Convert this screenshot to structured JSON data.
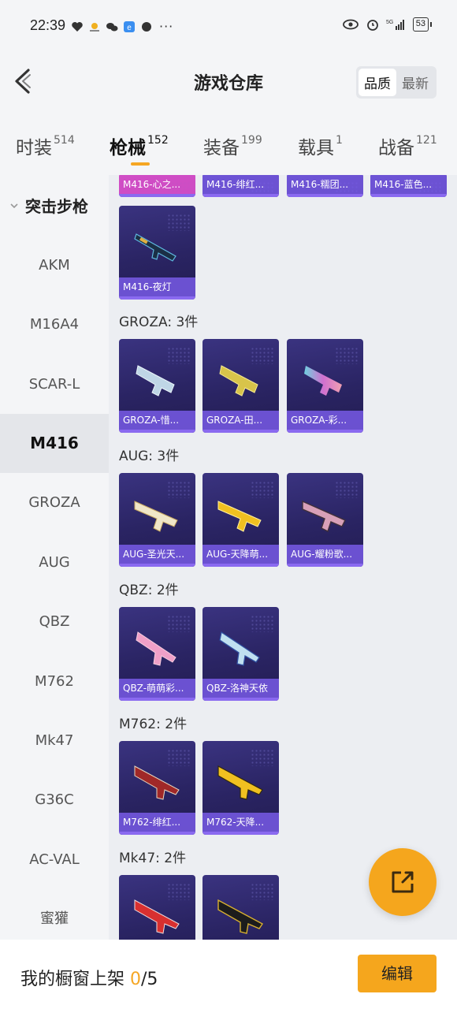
{
  "status_bar": {
    "time": "22:39",
    "dots": "···",
    "battery": "53"
  },
  "header": {
    "title": "游戏仓库",
    "sort_options": [
      "品质",
      "最新"
    ]
  },
  "tabs": [
    {
      "label": "时装",
      "count": "514"
    },
    {
      "label": "枪械",
      "count": "152"
    },
    {
      "label": "装备",
      "count": "199"
    },
    {
      "label": "载具",
      "count": "1"
    },
    {
      "label": "战备",
      "count": "121"
    }
  ],
  "sidebar": {
    "category": "突击步枪",
    "items": [
      "AKM",
      "M16A4",
      "SCAR-L",
      "M416",
      "GROZA",
      "AUG",
      "QBZ",
      "M762",
      "Mk47",
      "G36C",
      "AC-VAL",
      "蜜獾"
    ],
    "active": "M416"
  },
  "content": {
    "top_row": [
      "M416-心之...",
      "M416-绯红...",
      "M416-糯团...",
      "M416-蓝色..."
    ],
    "m416_extra": [
      "M416-夜灯"
    ],
    "sections": [
      {
        "title": "GROZA: 3件",
        "items": [
          "GROZA-惜...",
          "GROZA-田...",
          "GROZA-彩..."
        ]
      },
      {
        "title": "AUG: 3件",
        "items": [
          "AUG-圣光天...",
          "AUG-天降萌...",
          "AUG-耀粉歌..."
        ]
      },
      {
        "title": "QBZ: 2件",
        "items": [
          "QBZ-萌萌彩...",
          "QBZ-洛神天依"
        ]
      },
      {
        "title": "M762: 2件",
        "items": [
          "M762-绯红...",
          "M762-天降..."
        ]
      },
      {
        "title": "Mk47: 2件",
        "items": [
          "",
          ""
        ]
      }
    ]
  },
  "bottom_bar": {
    "shelf_label": "我的橱窗上架",
    "shelf_used": "0",
    "shelf_total": "/5",
    "edit_label": "编辑"
  },
  "colors": {
    "accent": "#f5a61d",
    "card_bg": "#2a2463",
    "card_label": "#7a5ae6"
  }
}
